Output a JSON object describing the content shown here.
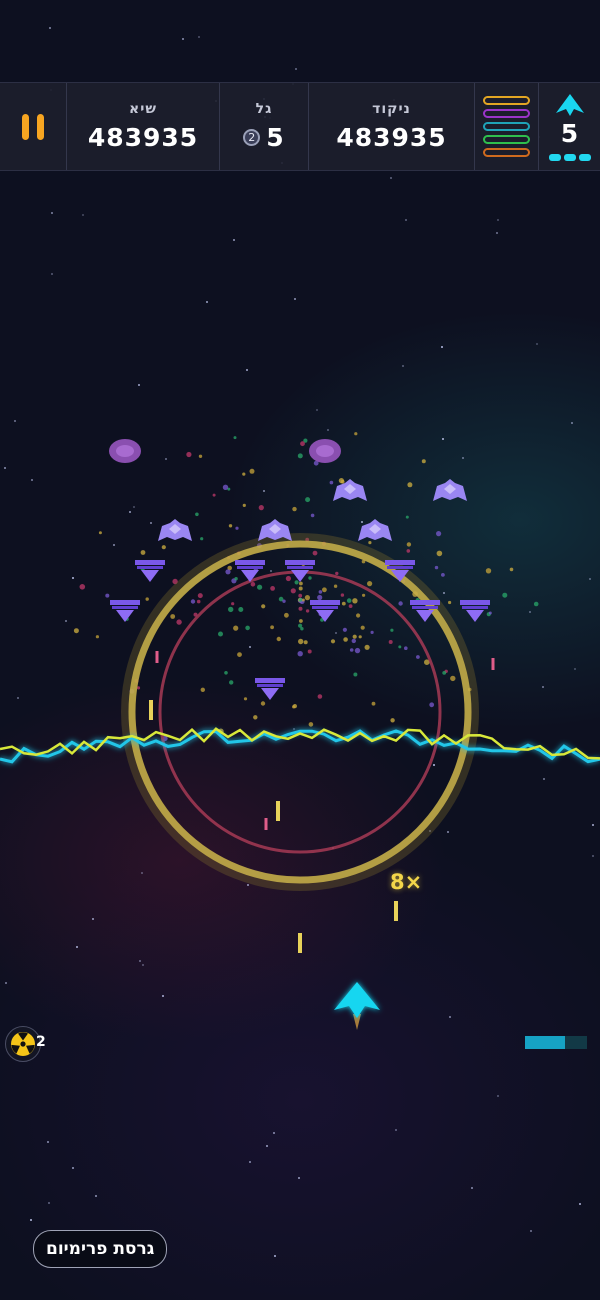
{
  "hud": {
    "best_label": "שיא",
    "best_value": "483935",
    "wave_label": "גל",
    "wave_value": "5",
    "wave_badge": "2",
    "score_label": "ניקוד",
    "score_value": "483935",
    "lives_value": "5",
    "lives_dots": 3,
    "power_bar_colors": [
      "#e3a623",
      "#9a34c9",
      "#1fa3b8",
      "#2fbf4d",
      "#cf6a1e"
    ]
  },
  "game": {
    "combo_text": "8×",
    "bomb_count": "2",
    "energy_fraction": 0.65,
    "player_color": "#19d6f0",
    "enemy_color": "#8b6ef7"
  },
  "footer": {
    "premium_label": "גרסת פרימיום"
  },
  "icons": {
    "pause": "pause-icon",
    "ship": "ship-icon",
    "bomb": "radiation-icon"
  }
}
